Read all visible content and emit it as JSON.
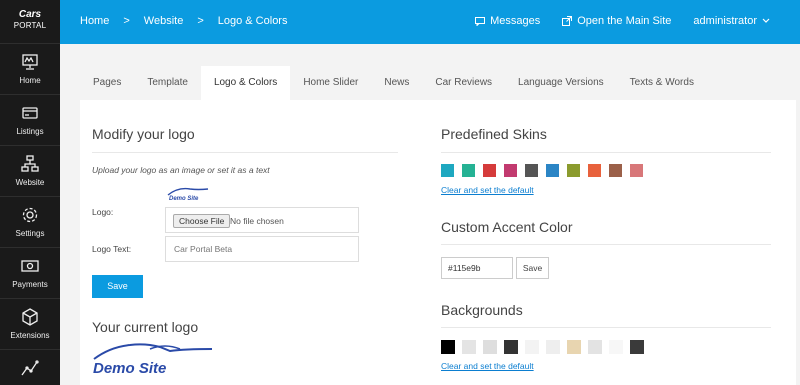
{
  "brand": {
    "line1": "Cars",
    "line2": "PORTAL"
  },
  "sidebar": {
    "items": [
      {
        "label": "Home",
        "icon": "home-monitor-icon"
      },
      {
        "label": "Listings",
        "icon": "card-icon"
      },
      {
        "label": "Website",
        "icon": "sitemap-icon"
      },
      {
        "label": "Settings",
        "icon": "gear-icon"
      },
      {
        "label": "Payments",
        "icon": "money-icon"
      },
      {
        "label": "Extensions",
        "icon": "cube-icon"
      },
      {
        "label": "",
        "icon": "chart-line-icon"
      }
    ]
  },
  "topbar": {
    "breadcrumb": [
      "Home",
      ">",
      "Website",
      ">",
      "Logo & Colors"
    ],
    "messages": "Messages",
    "open_site": "Open the Main Site",
    "user": "administrator",
    "color": "#0b9be0"
  },
  "tabs": [
    "Pages",
    "Template",
    "Logo & Colors",
    "Home Slider",
    "News",
    "Car Reviews",
    "Language Versions",
    "Texts & Words"
  ],
  "active_tab": "Logo & Colors",
  "logo_section": {
    "title": "Modify your logo",
    "note": "Upload your logo as an image or set it as a text",
    "logo_label": "Logo:",
    "choose_file": "Choose File",
    "no_file": "No file chosen",
    "text_label": "Logo Text:",
    "text_placeholder": "Car Portal Beta",
    "save": "Save",
    "current_title": "Your current logo",
    "logo_text": "Demo Site"
  },
  "skins": {
    "title": "Predefined Skins",
    "colors": [
      "#1ea8c0",
      "#25b294",
      "#d53b3b",
      "#c23a6f",
      "#555555",
      "#2b85c5",
      "#8b9b2e",
      "#e8613c",
      "#9b6049",
      "#d87779"
    ],
    "clear_link": "Clear and set the default"
  },
  "accent": {
    "title": "Custom Accent Color",
    "value": "#115e9b",
    "save": "Save"
  },
  "backgrounds": {
    "title": "Backgrounds",
    "colors": [
      "#000000",
      "#e4e4e4",
      "#dedede",
      "#333333",
      "#f3f3f3",
      "#eeeeee",
      "#e8d5b0",
      "#e3e3e3",
      "#f7f7f7",
      "#3a3a3a"
    ],
    "clear_link": "Clear and set the default"
  }
}
